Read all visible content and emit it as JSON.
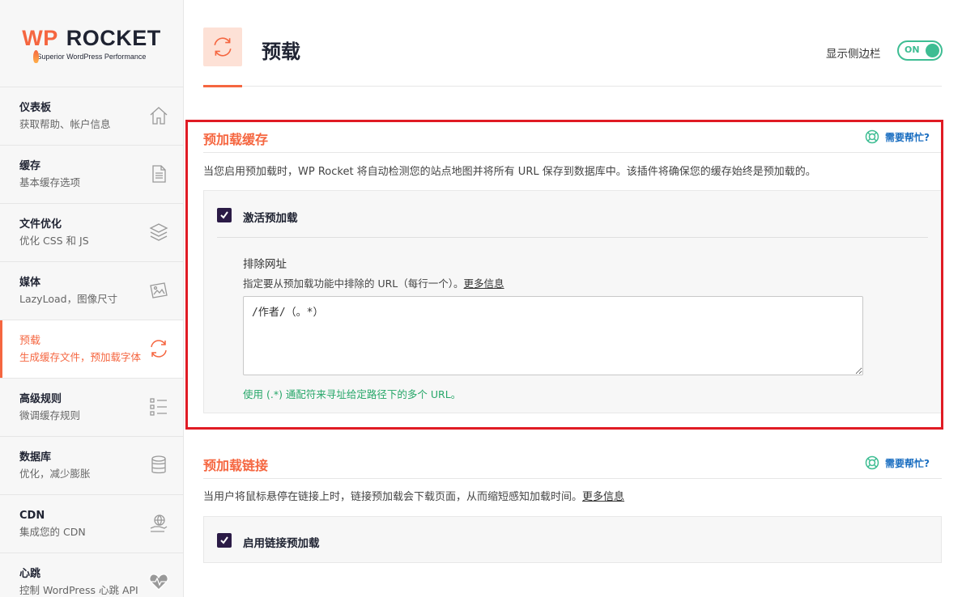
{
  "brand": {
    "logo_text_wp": "WP",
    "logo_text_rocket": "ROCKET",
    "tagline": "Superior WordPress Performance"
  },
  "sidebar": {
    "items": [
      {
        "title": "仪表板",
        "subtitle": "获取帮助、帐户信息",
        "icon": "home-icon"
      },
      {
        "title": "缓存",
        "subtitle": "基本缓存选项",
        "icon": "document-icon"
      },
      {
        "title": "文件优化",
        "subtitle": "优化 CSS 和 JS",
        "icon": "layers-icon"
      },
      {
        "title": "媒体",
        "subtitle": "LazyLoad，图像尺寸",
        "icon": "image-icon"
      },
      {
        "title": "预载",
        "subtitle": "生成缓存文件，预加载字体",
        "icon": "refresh-icon",
        "active": true
      },
      {
        "title": "高级规则",
        "subtitle": "微调缓存规则",
        "icon": "list-icon"
      },
      {
        "title": "数据库",
        "subtitle": "优化，减少膨胀",
        "icon": "database-icon"
      },
      {
        "title": "CDN",
        "subtitle": "集成您的 CDN",
        "icon": "globe-hand-icon"
      },
      {
        "title": "心跳",
        "subtitle": "控制 WordPress 心跳 API",
        "icon": "heartbeat-icon"
      }
    ]
  },
  "header": {
    "title": "预载",
    "icon": "refresh-icon",
    "sidebar_toggle_label": "显示侧边栏",
    "sidebar_toggle_state": "ON"
  },
  "preload_cache": {
    "title": "预加载缓存",
    "help_label": "需要帮忙?",
    "description": "当您启用预加载时，WP Rocket 将自动检测您的站点地图并将所有 URL 保存到数据库中。该插件将确保您的缓存始终是预加载的。",
    "activate_label": "激活预加载",
    "activate_checked": true,
    "exclude_title": "排除网址",
    "exclude_desc": "指定要从预加载功能中排除的 URL（每行一个）。",
    "more_info": "更多信息",
    "exclude_value": "/作者/（。*）",
    "hint": "使用 (.*) 通配符来寻址给定路径下的多个 URL。"
  },
  "preload_links": {
    "title": "预加载链接",
    "help_label": "需要帮忙?",
    "description": "当用户将鼠标悬停在链接上时，链接预加载会下载页面，从而缩短感知加载时间。",
    "more_info": "更多信息",
    "enable_label": "启用链接预加载",
    "enable_checked": true
  },
  "colors": {
    "accent": "#f56640",
    "toggle_on": "#3ebd93",
    "checkbox": "#2b1b46",
    "hint": "#27a769",
    "highlight_frame": "#e01b24"
  }
}
